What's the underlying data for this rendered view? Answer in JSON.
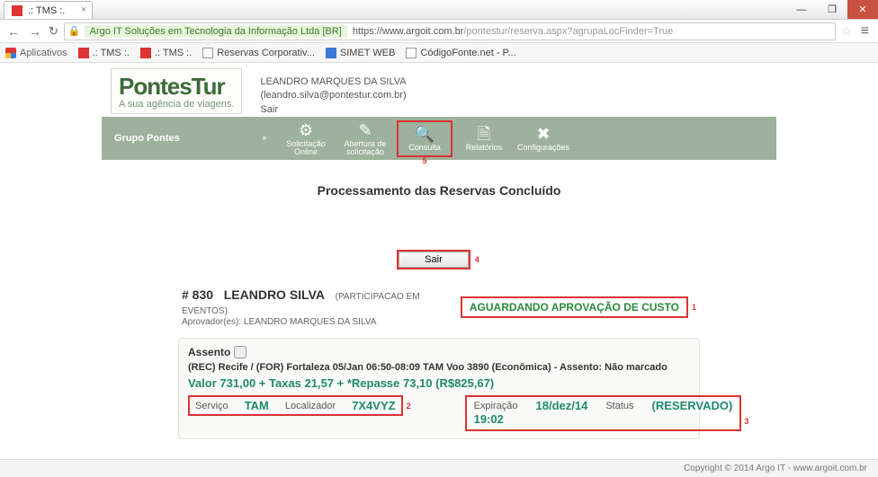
{
  "browser": {
    "tab_title": ".: TMS :.",
    "win_min": "—",
    "win_max": "❐",
    "win_close": "✕",
    "back": "←",
    "fwd": "→",
    "reload": "↻",
    "site_identity": "Argo IT Soluções em Tecnologia da Informação Ltda [BR]",
    "url_host": "https://www.argoit.com.br",
    "url_path": "/pontestur/reserva.aspx?agrupaLocFinder=True",
    "star": "☆",
    "menu": "≡",
    "bookmarks": {
      "apps": "Aplicativos",
      "b1": ".: TMS :.",
      "b2": ".: TMS :.",
      "b3": "Reservas Corporativ...",
      "b4": "SIMET WEB",
      "b5": "CódigoFonte.net - P..."
    }
  },
  "logo": {
    "main": "PontesTur",
    "sub": "A sua agência de viagens."
  },
  "user": {
    "name": "LEANDRO MARQUES DA SILVA",
    "email": "(leandro.silva@pontestur.com.br)",
    "logout": "Sair"
  },
  "group": "Grupo Pontes",
  "menu": {
    "m1": "Solicitação Online",
    "m2": "Abertura de solicitação",
    "m3": "Consulta",
    "m4": "Relatórios",
    "m5": "Configurações",
    "note5": "5"
  },
  "title": "Processamento das Reservas Concluído",
  "sair": {
    "label": "Sair",
    "note": "4"
  },
  "rec": {
    "id": "# 830",
    "name": "LEANDRO SILVA",
    "event": "(PARTICIPACAO EM EVENTOS)",
    "approver": "Aprovador(es): LEANDRO MARQUES DA SILVA",
    "status": "AGUARDANDO APROVAÇÃO DE CUSTO",
    "status_note": "1"
  },
  "seat": {
    "label": "Assento",
    "desc": "(REC) Recife / (FOR) Fortaleza 05/Jan 06:50-08:09 TAM Voo 3890 (Econômica) - Assento: Não marcado",
    "valor": "Valor 731,00 + Taxas 21,57 + *Repasse 73,10  (R$825,67)"
  },
  "svc": {
    "lbl_serv": "Serviço",
    "val_serv": "TAM",
    "lbl_loc": "Localizador",
    "val_loc": "7X4VYZ",
    "note": "2"
  },
  "exp": {
    "lbl_exp": "Expiração",
    "val_exp": "18/dez/14",
    "lbl_st": "Status",
    "val_st": "(RESERVADO)",
    "time": "19:02",
    "note": "3"
  },
  "footer": "Copyright © 2014 Argo IT   -   www.argoit.com.br"
}
